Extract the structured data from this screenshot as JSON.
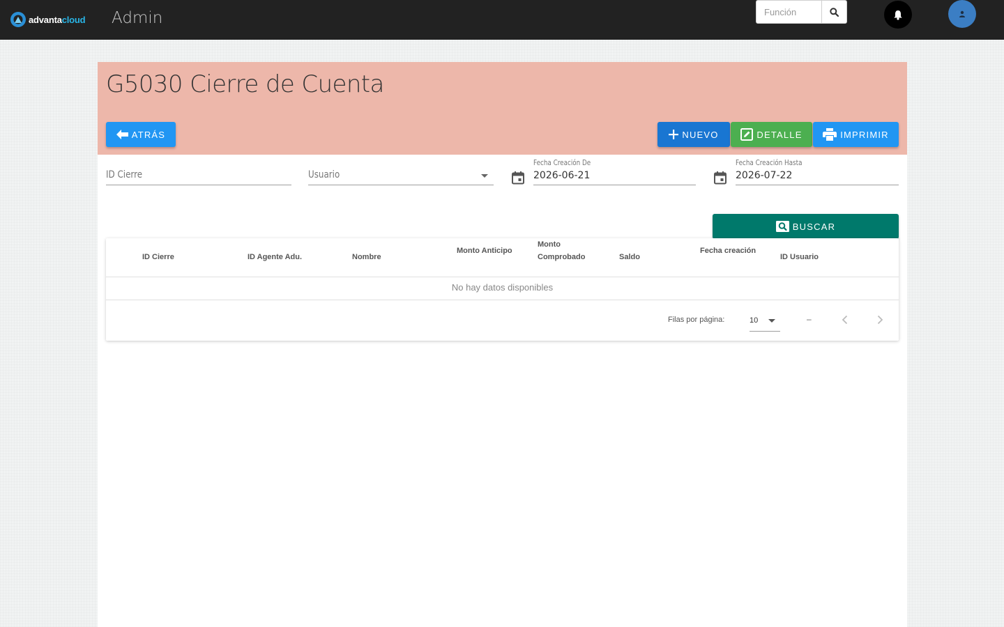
{
  "topbar": {
    "logo_brand": "advanta",
    "logo_accent": "cloud",
    "app_title": "Admin",
    "search_placeholder": "Función",
    "icons": [
      "search-icon",
      "bell-icon",
      "user-icon"
    ]
  },
  "page": {
    "title": "G5030 Cierre de Cuenta",
    "header_color": "#edb7aa",
    "buttons": {
      "back": "ATRÁS",
      "new": "NUEVO",
      "detail": "DETALLE",
      "print": "IMPRIMIR",
      "search": "BUSCAR"
    }
  },
  "filters": {
    "id_cierre_placeholder": "ID Cierre",
    "usuario_placeholder": "Usuario",
    "fecha_de_label": "Fecha Creación De",
    "fecha_de_value": "2026-06-21",
    "fecha_hasta_label": "Fecha Creación Hasta",
    "fecha_hasta_value": "2026-07-22"
  },
  "table": {
    "columns": [
      "ID Cierre",
      "ID Agente Adu.",
      "Nombre",
      "Monto Anticipo",
      "Monto Comprobado",
      "Saldo",
      "Fecha creación",
      "ID Usuario"
    ],
    "rows": [],
    "empty_text": "No hay datos disponibles",
    "rows_per_page_label": "Filas por página:",
    "rows_per_page_value": "10",
    "range_text": "–"
  },
  "colors": {
    "topbar": "#222222",
    "primary": "#2196f3",
    "new": "#1976d2",
    "detail": "#4caf50",
    "search": "#00796b"
  }
}
